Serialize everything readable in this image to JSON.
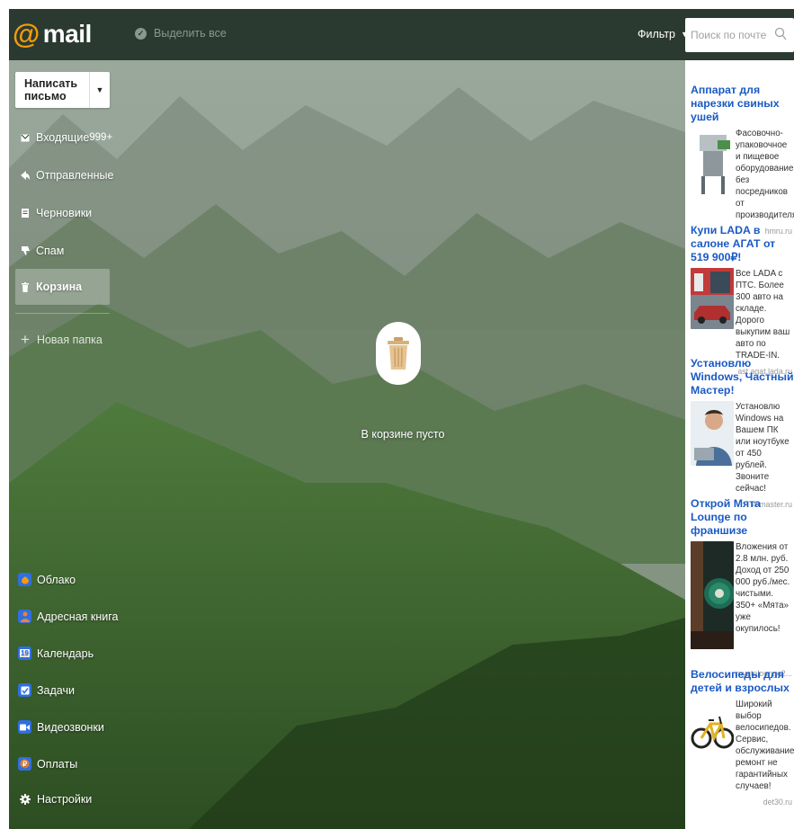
{
  "header": {
    "logo_at": "@",
    "logo_text": "mail",
    "select_all": "Выделить все",
    "filter": "Фильтр",
    "search_placeholder": "Поиск по почте"
  },
  "sidebar": {
    "compose": "Написать письмо",
    "folders": [
      {
        "label": "Входящие",
        "count": "999+"
      },
      {
        "label": "Отправленные"
      },
      {
        "label": "Черновики"
      },
      {
        "label": "Спам"
      },
      {
        "label": "Корзина",
        "active": true
      }
    ],
    "new_folder": "Новая папка",
    "services": [
      {
        "label": "Облако",
        "icon": "cloud-icon",
        "color": "#2f6fe0"
      },
      {
        "label": "Адресная книга",
        "icon": "contacts-icon",
        "color": "#f0822e"
      },
      {
        "label": "Календарь",
        "icon": "calendar-icon",
        "color": "#2f6fe0",
        "glyph": "19"
      },
      {
        "label": "Задачи",
        "icon": "tasks-icon",
        "color": "#2f6fe0"
      },
      {
        "label": "Видеозвонки",
        "icon": "video-call-icon",
        "color": "#2f6fe0"
      },
      {
        "label": "Оплаты",
        "icon": "payments-icon",
        "color": "#f0822e"
      },
      {
        "label": "Настройки",
        "icon": "settings-icon",
        "color": "transparent"
      }
    ]
  },
  "main": {
    "empty_message": "В корзине пусто"
  },
  "ads": [
    {
      "title": "Аппарат для нарезки свиных ушей",
      "desc": "Фасовочно-упаковочное и пищевое оборудование без посредников от производителя.",
      "domain": "hmru.ru"
    },
    {
      "title": "Купи LADA в салоне АГАТ от 519 900₽!",
      "desc": "Все LADA с ПТС. Более 300 авто на складе. Дорого выкупим ваш авто по TRADE-IN.",
      "domain": "ast.agat.lada.ru"
    },
    {
      "title": "Установлю Windows, Частный Мастер!",
      "desc": "Установлю Windows на Вашем ПК или ноутбуке от 450 рублей. Звоните сейчас!",
      "domain": "4-master.ru"
    },
    {
      "title": "Открой Мята Lounge по франшизе",
      "desc": "Вложения от 2.8 млн. руб. Доход от 250 000 руб./мес. чистыми. 350+ «Мята» уже окупилось!",
      "domain": "myatalounge2..."
    },
    {
      "title": "Велосипеды для детей и взрослых",
      "desc": "Широкий выбор велосипедов. Сервис, обслуживание, ремонт не гарантийных случаев!",
      "domain": "det30.ru"
    }
  ],
  "colors": {
    "header_bg": "#2b3a31",
    "accent": "#f49b0b",
    "ad_title": "#1a5ac4"
  }
}
